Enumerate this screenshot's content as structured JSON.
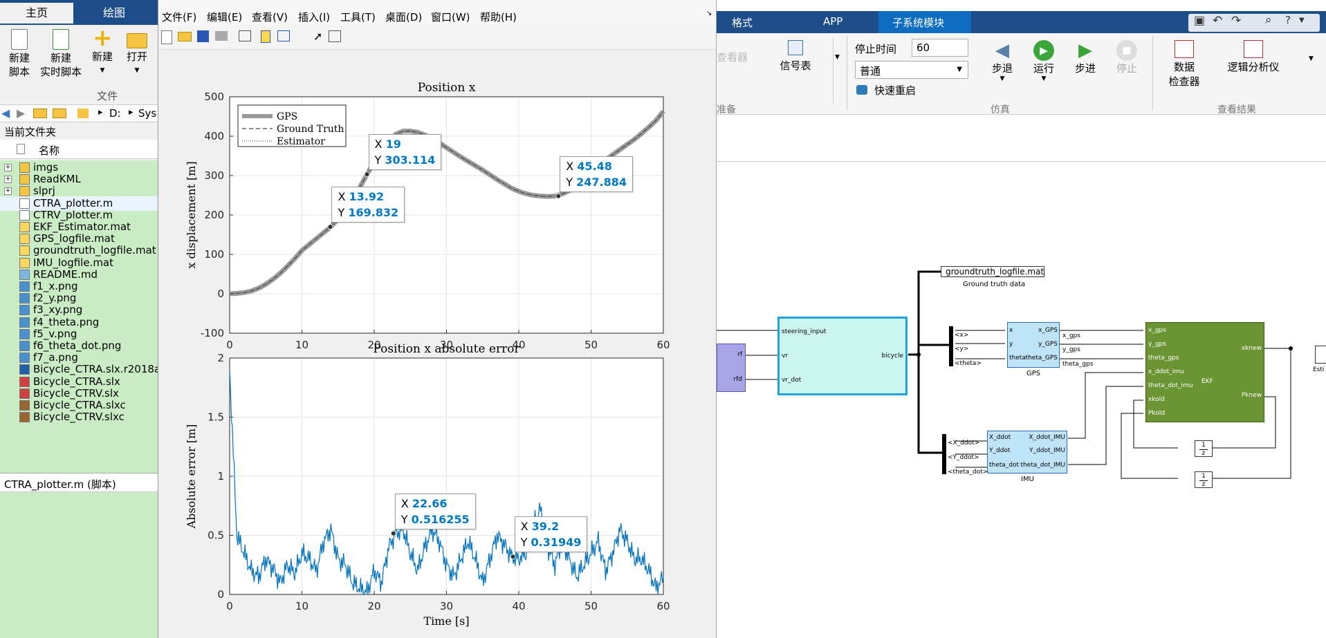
{
  "matlab": {
    "tabs": [
      "主页",
      "绘图"
    ],
    "toolbar": {
      "new_script": [
        "新建",
        "脚本"
      ],
      "new_live_script": [
        "新建",
        "实时脚本"
      ],
      "new": "新建",
      "open": "打开",
      "group_file": "文件"
    },
    "path": [
      "D:",
      "Sys"
    ],
    "current_folder_label": "当前文件夹",
    "name_column": "名称",
    "files": [
      {
        "name": "imgs",
        "type": "folder"
      },
      {
        "name": "ReadKML",
        "type": "folder"
      },
      {
        "name": "slprj",
        "type": "folder"
      },
      {
        "name": "CTRA_plotter.m",
        "type": "m",
        "selected": true
      },
      {
        "name": "CTRV_plotter.m",
        "type": "m"
      },
      {
        "name": "EKF_Estimator.mat",
        "type": "mat"
      },
      {
        "name": "GPS_logfile.mat",
        "type": "mat"
      },
      {
        "name": "groundtruth_logfile.mat",
        "type": "mat"
      },
      {
        "name": "IMU_logfile.mat",
        "type": "mat"
      },
      {
        "name": "README.md",
        "type": "md"
      },
      {
        "name": "f1_x.png",
        "type": "png"
      },
      {
        "name": "f2_y.png",
        "type": "png"
      },
      {
        "name": "f3_xy.png",
        "type": "png"
      },
      {
        "name": "f4_theta.png",
        "type": "png"
      },
      {
        "name": "f5_v.png",
        "type": "png"
      },
      {
        "name": "f6_theta_dot.png",
        "type": "png"
      },
      {
        "name": "f7_a.png",
        "type": "png"
      },
      {
        "name": "Bicycle_CTRA.slx.r2018a",
        "type": "r"
      },
      {
        "name": "Bicycle_CTRA.slx",
        "type": "slx"
      },
      {
        "name": "Bicycle_CTRV.slx",
        "type": "slx"
      },
      {
        "name": "Bicycle_CTRA.slxc",
        "type": "slxc"
      },
      {
        "name": "Bicycle_CTRV.slxc",
        "type": "slxc"
      }
    ],
    "details_label": "CTRA_plotter.m  (脚本)"
  },
  "figure": {
    "menu": [
      "文件(F)",
      "编辑(E)",
      "查看(V)",
      "插入(I)",
      "工具(T)",
      "桌面(D)",
      "窗口(W)",
      "帮助(H)"
    ]
  },
  "chart_data": [
    {
      "type": "line",
      "title": "Position x",
      "xlabel": "",
      "ylabel": "x displacement [m]",
      "xlim": [
        0,
        60
      ],
      "ylim": [
        -100,
        500
      ],
      "xticks": [
        "0",
        "10",
        "20",
        "30",
        "40",
        "50",
        "60"
      ],
      "yticks": [
        "-100",
        "0",
        "100",
        "200",
        "300",
        "400",
        "500"
      ],
      "grid": true,
      "legend_position": "top-left",
      "series": [
        {
          "name": "GPS",
          "style": "thick-gray"
        },
        {
          "name": "Ground Truth",
          "style": "dashed"
        },
        {
          "name": "Estimator",
          "style": "dotted"
        }
      ],
      "x": [
        0,
        1,
        2,
        3,
        4,
        5,
        6,
        7,
        8,
        9,
        10,
        11,
        12,
        13,
        14,
        15,
        16,
        17,
        18,
        19,
        20,
        21,
        22,
        23,
        24,
        25,
        26,
        27,
        28,
        29,
        30,
        31,
        32,
        33,
        34,
        35,
        36,
        37,
        38,
        39,
        40,
        41,
        42,
        43,
        44,
        45,
        46,
        47,
        48,
        49,
        50,
        51,
        52,
        53,
        54,
        55,
        56,
        57,
        58,
        59,
        60
      ],
      "y": [
        0,
        1,
        3,
        7,
        14,
        24,
        37,
        52,
        70,
        89,
        110,
        125,
        140,
        155,
        170,
        190,
        215,
        240,
        270,
        303,
        335,
        360,
        385,
        405,
        413,
        413,
        410,
        403,
        394,
        383,
        371,
        359,
        347,
        336,
        325,
        314,
        302,
        290,
        279,
        268,
        260,
        254,
        250,
        248,
        247,
        248,
        253,
        262,
        276,
        294,
        314,
        327,
        340,
        353,
        366,
        379,
        392,
        407,
        423,
        440,
        463
      ],
      "data_tips": [
        {
          "x": "13.92",
          "y": "169.832"
        },
        {
          "x": "19",
          "y": "303.114"
        },
        {
          "x": "45.48",
          "y": "247.884"
        }
      ]
    },
    {
      "type": "line",
      "title": "Position x absolute error",
      "xlabel": "Time [s]",
      "ylabel": "Absolute error [m]",
      "xlim": [
        0,
        60
      ],
      "ylim": [
        0,
        2
      ],
      "xticks": [
        "0",
        "10",
        "20",
        "30",
        "40",
        "50",
        "60"
      ],
      "yticks": [
        "0",
        "0.5",
        "1",
        "1.5",
        "2"
      ],
      "grid": true,
      "series": [
        {
          "name": "",
          "color": "#0072bd"
        }
      ],
      "x": [
        0,
        1,
        2,
        3,
        4,
        5,
        6,
        7,
        8,
        9,
        10,
        11,
        12,
        13,
        14,
        15,
        16,
        17,
        18,
        19,
        20,
        21,
        22,
        23,
        24,
        25,
        26,
        27,
        28,
        29,
        30,
        31,
        32,
        33,
        34,
        35,
        36,
        37,
        38,
        39,
        40,
        41,
        42,
        43,
        44,
        45,
        46,
        47,
        48,
        49,
        50,
        51,
        52,
        53,
        54,
        55,
        56,
        57,
        58,
        59,
        60
      ],
      "y": [
        1.9,
        0.5,
        0.35,
        0.2,
        0.15,
        0.3,
        0.22,
        0.1,
        0.25,
        0.18,
        0.35,
        0.3,
        0.2,
        0.45,
        0.55,
        0.3,
        0.25,
        0.1,
        0.05,
        0.02,
        0.2,
        0.1,
        0.4,
        0.52,
        0.55,
        0.35,
        0.2,
        0.4,
        0.55,
        0.45,
        0.25,
        0.15,
        0.3,
        0.45,
        0.3,
        0.1,
        0.3,
        0.5,
        0.42,
        0.32,
        0.3,
        0.35,
        0.6,
        0.72,
        0.4,
        0.25,
        0.45,
        0.3,
        0.15,
        0.25,
        0.35,
        0.45,
        0.2,
        0.35,
        0.55,
        0.45,
        0.3,
        0.3,
        0.2,
        0.05,
        0.15
      ],
      "data_tips": [
        {
          "x": "22.66",
          "y": "0.516255"
        },
        {
          "x": "39.2",
          "y": "0.31949"
        }
      ]
    }
  ],
  "simulink": {
    "tabs": [
      "格式",
      "APP",
      "子系统模块"
    ],
    "stop_time_label": "停止时间",
    "stop_time_value": "60",
    "mode_value": "普通",
    "fast_restart": "快速重启",
    "viewer_label": "查看器",
    "signal_table": "信号表",
    "step_back": "步退",
    "run": "运行",
    "step_forward": "步进",
    "stop": "停止",
    "data_inspector": [
      "数据",
      "检查器"
    ],
    "logic_analyzer": "逻辑分析仪",
    "group_prepare": "准备",
    "group_simulation": "仿真",
    "group_review": "查看结果",
    "blocks": {
      "groundtruth_file": "groundtruth_logfile.mat",
      "groundtruth_caption": "Ground truth data",
      "bicycle_inputs": [
        "steering_input",
        "vr",
        "vr_dot"
      ],
      "bicycle_output": "bicycle",
      "gen_ports": [
        "rf",
        "rfd"
      ],
      "bus_sel1": [
        "<x>",
        "<y>",
        "<theta>"
      ],
      "gps_in": [
        "x",
        "y",
        "theta"
      ],
      "gps_out": [
        "x_GPS",
        "y_GPS",
        "theta_GPS"
      ],
      "gps_caption": "GPS",
      "gps_signals": [
        "x_gps",
        "y_gps",
        "theta_gps"
      ],
      "bus_sel2": [
        "<X_ddot>",
        "<Y_ddot>",
        "<theta_dot>"
      ],
      "imu_in": [
        "X_ddot",
        "Y_ddot",
        "theta_dot"
      ],
      "imu_out": [
        "X_ddot_IMU",
        "Y_ddot_IMU",
        "theta_dot_IMU"
      ],
      "imu_caption": "IMU",
      "ekf_in": [
        "x_gps",
        "y_gps",
        "theta_gps",
        "x_ddot_imu",
        "theta_dot_imu",
        "xkold",
        "Pkold"
      ],
      "ekf_out": [
        "xknew",
        "Pknew"
      ],
      "ekf_caption": "EKF",
      "delay": [
        "1",
        "z"
      ],
      "est_caption": "Esti"
    }
  }
}
